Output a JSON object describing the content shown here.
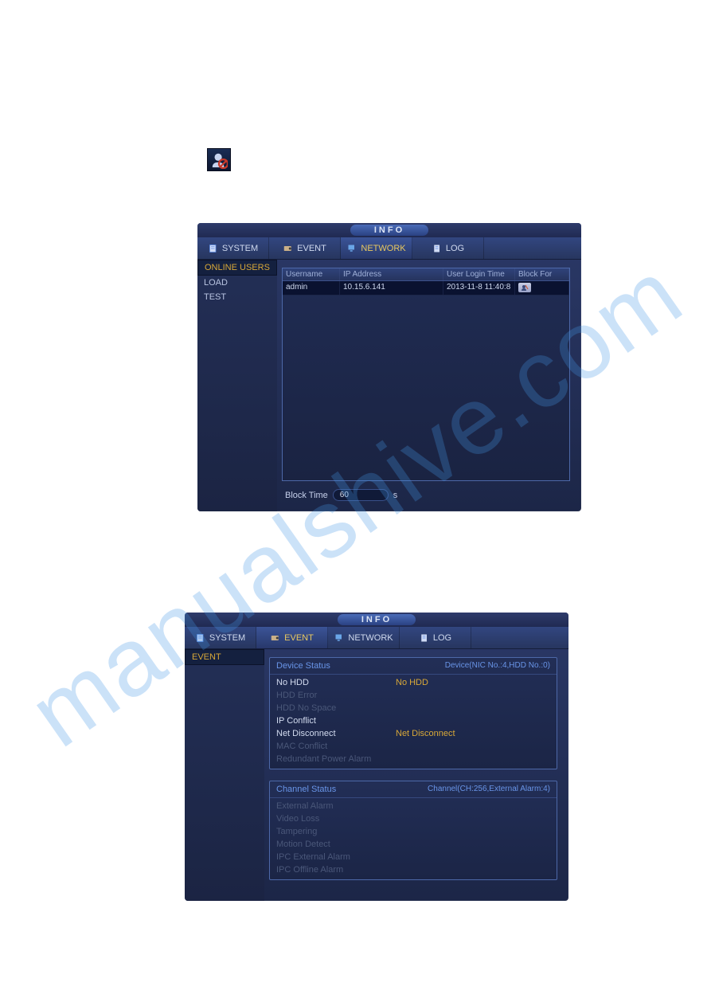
{
  "watermark": "manualshive.com",
  "window_title": "INFO",
  "tabs": {
    "system": "SYSTEM",
    "event": "EVENT",
    "network": "NETWORK",
    "log": "LOG"
  },
  "window1": {
    "sidebar": {
      "items": [
        {
          "label": "ONLINE USERS",
          "active": true
        },
        {
          "label": "LOAD",
          "active": false
        },
        {
          "label": "TEST",
          "active": false
        }
      ]
    },
    "grid": {
      "headers": {
        "username": "Username",
        "ip": "IP Address",
        "login_time": "User Login Time",
        "block_for": "Block For"
      },
      "rows": [
        {
          "username": "admin",
          "ip": "10.15.6.141",
          "login_time": "2013-11-8 11:40:8"
        }
      ]
    },
    "block_time": {
      "label": "Block Time",
      "value": "60",
      "unit": "s"
    }
  },
  "window2": {
    "sidebar": {
      "items": [
        {
          "label": "EVENT",
          "active": true
        }
      ]
    },
    "device_panel": {
      "title": "Device Status",
      "summary": "Device(NIC No.:4,HDD No.:0)",
      "rows": [
        {
          "label": "No HDD",
          "value": "No HDD",
          "enabled": true
        },
        {
          "label": "HDD Error",
          "value": "",
          "enabled": false
        },
        {
          "label": "HDD No Space",
          "value": "",
          "enabled": false
        },
        {
          "label": "IP Conflict",
          "value": "",
          "enabled": true
        },
        {
          "label": "Net Disconnect",
          "value": "Net Disconnect",
          "enabled": true
        },
        {
          "label": "MAC Conflict",
          "value": "",
          "enabled": false
        },
        {
          "label": "Redundant Power Alarm",
          "value": "",
          "enabled": false
        }
      ]
    },
    "channel_panel": {
      "title": "Channel Status",
      "summary": "Channel(CH:256,External Alarm:4)",
      "rows": [
        {
          "label": "External Alarm",
          "value": "",
          "enabled": false
        },
        {
          "label": "Video Loss",
          "value": "",
          "enabled": false
        },
        {
          "label": "Tampering",
          "value": "",
          "enabled": false
        },
        {
          "label": "Motion Detect",
          "value": "",
          "enabled": false
        },
        {
          "label": "IPC External Alarm",
          "value": "",
          "enabled": false
        },
        {
          "label": "IPC Offline Alarm",
          "value": "",
          "enabled": false
        }
      ]
    }
  }
}
